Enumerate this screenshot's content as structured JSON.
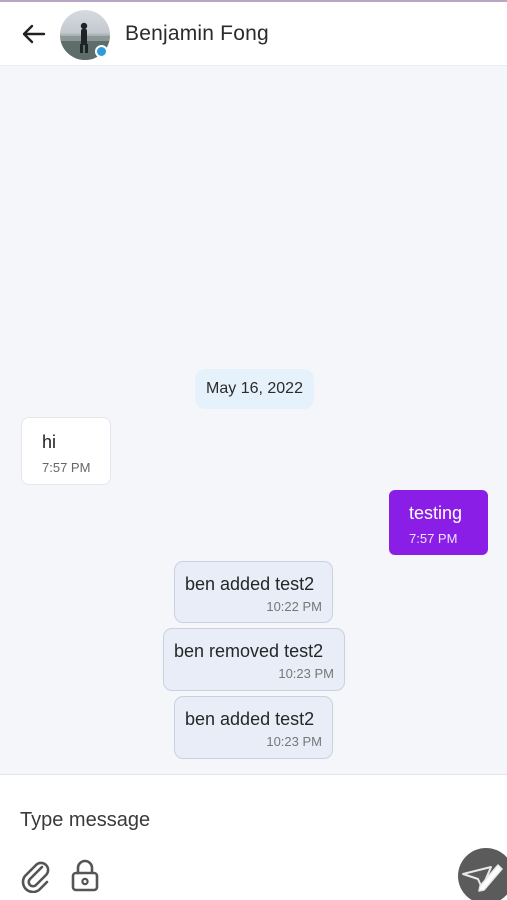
{
  "header": {
    "back_icon": "arrow-left-icon",
    "contact_name": "Benjamin Fong",
    "avatar_badge_color": "#2d9cdb"
  },
  "messages": {
    "date_separator": "May 16, 2022",
    "incoming": {
      "text": "hi",
      "time": "7:57 PM"
    },
    "outgoing": {
      "text": "testing",
      "time": "7:57 PM",
      "color": "#8a1de6"
    },
    "system": [
      {
        "text": "ben added test2",
        "time": "10:22 PM"
      },
      {
        "text": "ben removed test2",
        "time": "10:23 PM"
      },
      {
        "text": "ben added test2",
        "time": "10:23 PM"
      }
    ]
  },
  "composer": {
    "placeholder": "Type message",
    "attach_icon": "paperclip-icon",
    "lock_icon": "lock-icon",
    "send_icon": "send-pencil-icon"
  }
}
